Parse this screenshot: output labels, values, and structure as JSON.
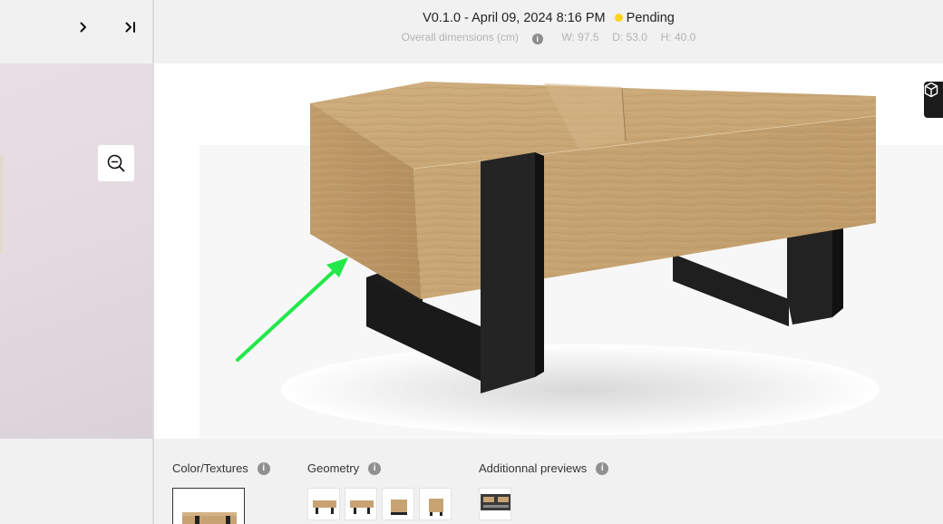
{
  "header": {
    "version": "V0.1.0 - April 09, 2024 8:16 PM",
    "status": "Pending",
    "status_color": "#ffd21f",
    "dims_label": "Overall dimensions (cm)",
    "width": "W: 97.5",
    "depth": "D: 53.0",
    "height": "H: 40.0"
  },
  "left_nav": {
    "next_icon": "chevron-right-icon",
    "last_icon": "skip-to-end-icon",
    "zoom_icon": "zoom-out-icon"
  },
  "viewer": {
    "cube_icon": "3d-cube-icon",
    "arrow_color": "#22e84a"
  },
  "sections": {
    "colors": {
      "label": "Color/Textures"
    },
    "geometry": {
      "label": "Geometry"
    },
    "previews": {
      "label": "Additionnal previews"
    }
  }
}
